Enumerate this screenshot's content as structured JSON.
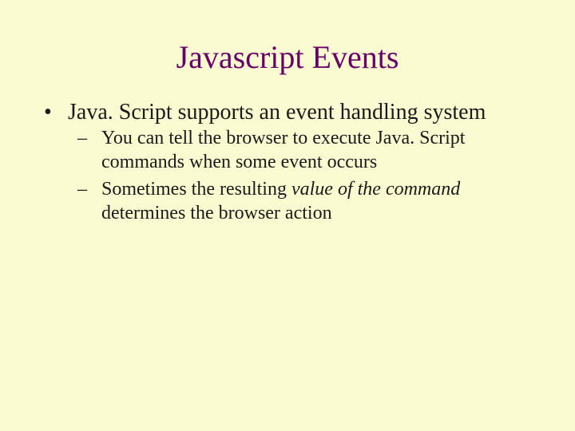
{
  "slide": {
    "title": "Javascript Events",
    "bullet1": "Java. Script supports an event handling system",
    "sub1a": "You can tell the browser to execute Java. Script commands when some event occurs",
    "sub1b_prefix": "Sometimes the resulting ",
    "sub1b_italic": "value of the command",
    "sub1b_suffix": " determines the browser action"
  }
}
